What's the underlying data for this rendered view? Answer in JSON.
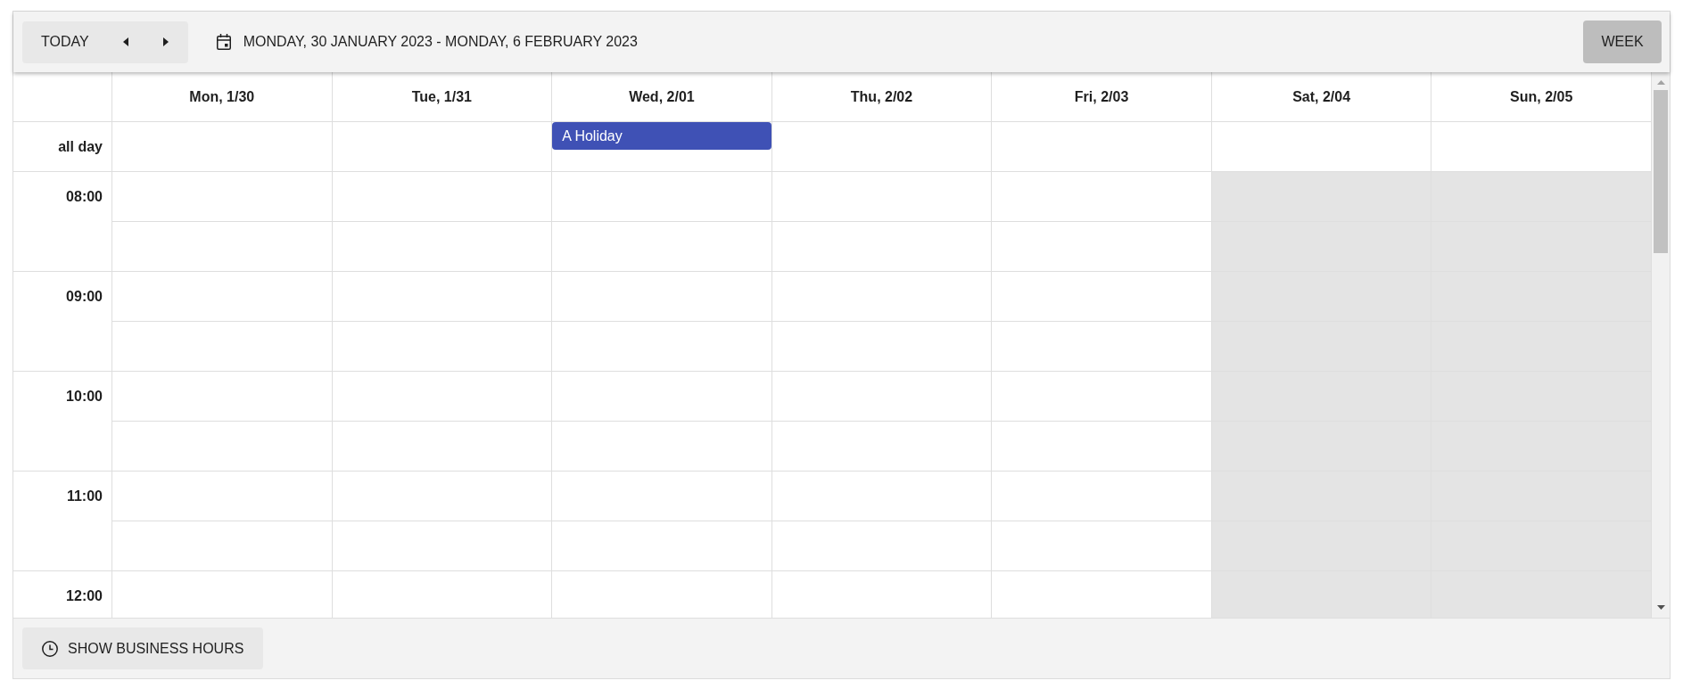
{
  "toolbar": {
    "today_button": "TODAY",
    "date_range": "MONDAY, 30 JANUARY 2023 - MONDAY, 6 FEBRUARY 2023",
    "view_buttons": [
      {
        "label": "WEEK",
        "selected": true
      }
    ]
  },
  "calendar": {
    "all_day_label": "all day",
    "days": [
      {
        "header": "Mon, 1/30",
        "weekend": false
      },
      {
        "header": "Tue, 1/31",
        "weekend": false
      },
      {
        "header": "Wed, 2/01",
        "weekend": false,
        "all_day_events": [
          {
            "title": "A Holiday"
          }
        ]
      },
      {
        "header": "Thu, 2/02",
        "weekend": false
      },
      {
        "header": "Fri, 2/03",
        "weekend": false
      },
      {
        "header": "Sat, 2/04",
        "weekend": true
      },
      {
        "header": "Sun, 2/05",
        "weekend": true
      }
    ],
    "hours": [
      {
        "label": "08:00"
      },
      {
        "label": "09:00"
      },
      {
        "label": "10:00"
      },
      {
        "label": "11:00"
      },
      {
        "label": "12:00"
      }
    ]
  },
  "footer": {
    "business_hours_button": "SHOW BUSINESS HOURS"
  }
}
